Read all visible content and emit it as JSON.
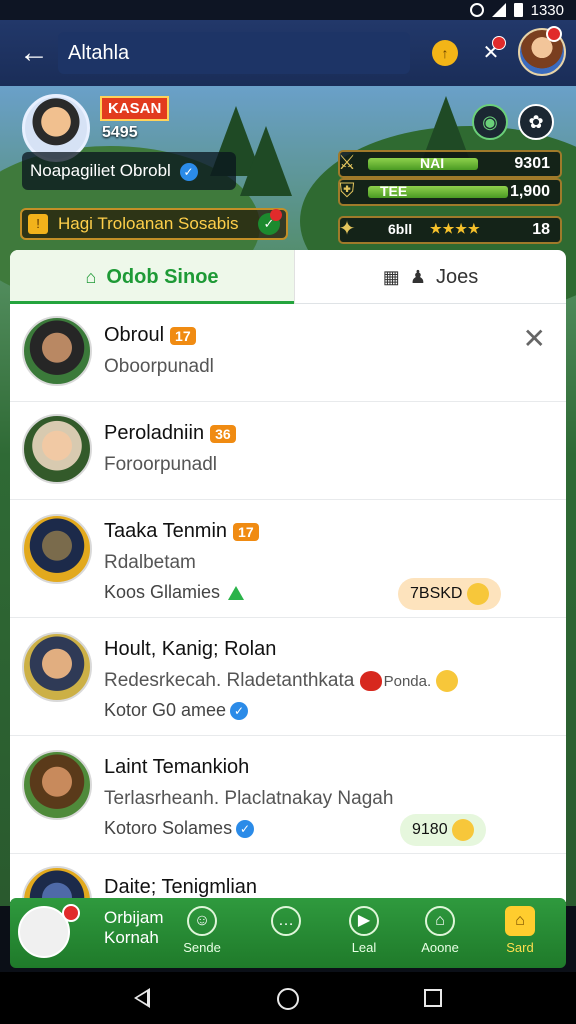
{
  "status_bar": {
    "time": "1330"
  },
  "app_bar": {
    "title": "Altahla"
  },
  "player": {
    "level_badge": "KASAN",
    "score": "5495",
    "name": "Noapagiliet Obrobl"
  },
  "quest": {
    "label": "Hagi Troloanan Sosabis"
  },
  "stats": [
    {
      "label": "NAI",
      "value": "9301",
      "fill": 0.45
    },
    {
      "label": "TEE",
      "value": "1,900",
      "fill": 0.65
    },
    {
      "label": "6bll",
      "value": "18",
      "stars": "★★★★"
    }
  ],
  "tabs": [
    {
      "label": "Odob Sinoe"
    },
    {
      "label": "Joes"
    }
  ],
  "friends": [
    {
      "name": "Obroul",
      "level": "17",
      "subtitle": "Oboorpunadl",
      "meta": ""
    },
    {
      "name": "Peroladniin",
      "level": "36",
      "subtitle": "Foroorpunadl",
      "meta": ""
    },
    {
      "name": "Taaka Tenmin",
      "level": "17",
      "subtitle": "Rdalbetam",
      "meta": "Koos Gllamies",
      "pill": "7BSKD"
    },
    {
      "name": "Hoult, Kanig; Rolan",
      "subtitle": "Redesrkecah. Rladetanthkata",
      "meta": "Kotor G0 amee",
      "reaction": "Ponda."
    },
    {
      "name": "Laint Temankioh",
      "subtitle": "Terlasrheanh. Placlatnakay Nagah",
      "meta": "Kotoro Solames",
      "pill": "9180"
    },
    {
      "name": "Daite; Tenigmlian"
    }
  ],
  "bottom_nav": {
    "profile_line1": "Orbijam",
    "profile_line2": "Kornah",
    "items": [
      {
        "label": "Sende",
        "icon": "person-icon"
      },
      {
        "label": "",
        "icon": "chat-icon"
      },
      {
        "label": "Leal",
        "icon": "play-icon"
      },
      {
        "label": "Aoone",
        "icon": "home-icon"
      },
      {
        "label": "Sard",
        "icon": "shop-icon"
      }
    ]
  }
}
